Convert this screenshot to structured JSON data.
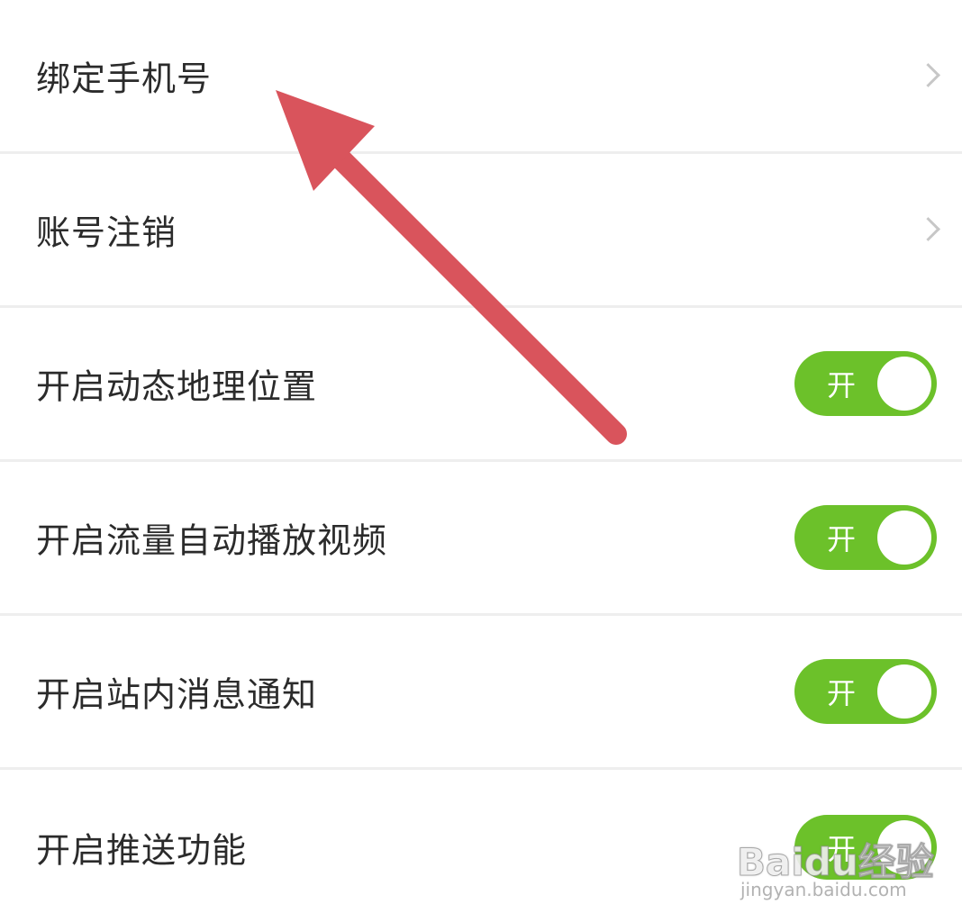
{
  "settings": {
    "items": [
      {
        "label": "绑定手机号",
        "control": "chevron"
      },
      {
        "label": "账号注销",
        "control": "chevron"
      },
      {
        "label": "开启动态地理位置",
        "control": "toggle",
        "toggle_text": "开",
        "state": "on"
      },
      {
        "label": "开启流量自动播放视频",
        "control": "toggle",
        "toggle_text": "开",
        "state": "on"
      },
      {
        "label": "开启站内消息通知",
        "control": "toggle",
        "toggle_text": "开",
        "state": "on"
      },
      {
        "label": "开启推送功能",
        "control": "toggle",
        "toggle_text": "开",
        "state": "on"
      }
    ]
  },
  "colors": {
    "toggle_on": "#6cc12a",
    "arrow": "#d9545c",
    "divider": "#eeeeee",
    "chevron": "#c7c7c7",
    "text": "#2b2b2b"
  },
  "watermark": {
    "brand": "Baidu经验",
    "url": "jingyan.baidu.com"
  }
}
